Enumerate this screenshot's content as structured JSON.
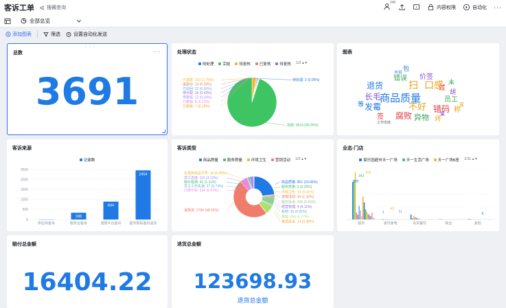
{
  "header": {
    "title": "客诉工单",
    "feedback_label": "搜藏查询",
    "notification_count": "246",
    "permission_label": "内容权限",
    "automation_label": "自动化"
  },
  "view": {
    "selected": "全部总览"
  },
  "toolbar": {
    "add_chart": "添加图表",
    "filter": "筛选",
    "auto_send": "设置自动化发送"
  },
  "cards": {
    "total": {
      "title": "总数",
      "value": "3691"
    },
    "status": {
      "title": "处理状态"
    },
    "wordcloud": {
      "title": "图表"
    },
    "source": {
      "title": "客诉来源"
    },
    "type": {
      "title": "客诉类型"
    },
    "store": {
      "title": "业态-门店"
    },
    "compensation": {
      "title": "赔付总金额",
      "value": "16404.22"
    },
    "refund": {
      "title": "退货总金额",
      "value": "123698.93",
      "caption": "退货总金额"
    }
  },
  "wordcloud_words": [
    {
      "text": "商品质量",
      "color": "#1f7ae6"
    },
    {
      "text": "扫",
      "color": "#e8a317"
    },
    {
      "text": "口感",
      "color": "#e8a317"
    },
    {
      "text": "退货",
      "color": "#1f7ae6"
    },
    {
      "text": "价签",
      "color": "#8a4fd8"
    },
    {
      "text": "错误",
      "color": "#3aa655"
    },
    {
      "text": "长毛",
      "color": "#8a4fd8"
    },
    {
      "text": "发霉",
      "color": "#1f7ae6"
    },
    {
      "text": "不好",
      "color": "#e8a317"
    },
    {
      "text": "错码",
      "color": "#d83b3b"
    },
    {
      "text": "员工",
      "color": "#3aa655"
    },
    {
      "text": "腐败",
      "color": "#d83b3b"
    },
    {
      "text": "异物",
      "color": "#3aa655"
    },
    {
      "text": "坏",
      "color": "#e8a317"
    },
    {
      "text": "包",
      "color": "#1f7ae6"
    },
    {
      "text": "过",
      "color": "#d83b3b"
    },
    {
      "text": "称",
      "color": "#e8a317"
    },
    {
      "text": "胡",
      "color": "#8a4fd8"
    },
    {
      "text": "未",
      "color": "#3aa655"
    },
    {
      "text": "等",
      "color": "#1f7ae6"
    },
    {
      "text": "签",
      "color": "#d83b3b"
    },
    {
      "text": "不符",
      "color": "#1f7ae6"
    },
    {
      "text": "工作态度",
      "color": "#646a73"
    },
    {
      "text": "客",
      "color": "#e8a317"
    },
    {
      "text": "量",
      "color": "#8a4fd8"
    }
  ],
  "chart_data": [
    {
      "type": "pie",
      "title": "处理状态",
      "legend": [
        "待处理",
        "完结",
        "待复核",
        "已复核",
        "待复核"
      ],
      "legend_colors": [
        "#1f7ae6",
        "#3fc464",
        "#f5b62a",
        "#f07c6b",
        "#9c6ad9"
      ],
      "legend_page": "1/2",
      "slices": [
        {
          "label": "完结",
          "value": 3514,
          "pct": "95.20%",
          "color": "#3fc464"
        },
        {
          "label": "已退款",
          "value": 103,
          "pct": "2.79%",
          "color": "#f5b62a"
        },
        {
          "label": "退款中",
          "value": 14,
          "pct": "0.38%",
          "color": "#f07c6b"
        },
        {
          "label": "已驳回",
          "value": 22,
          "pct": "0.60%",
          "color": "#5ab0e8"
        },
        {
          "label": "待分配",
          "value": 16,
          "pct": "0.43%",
          "color": "#9c6ad9"
        },
        {
          "label": "待复核",
          "value": 12,
          "pct": "0.33%",
          "color": "#a78bfa"
        },
        {
          "label": "已撤销",
          "value": 8,
          "pct": "0.22%",
          "color": "#e88adf"
        },
        {
          "label": "已复核",
          "value": 7,
          "pct": "0.19%",
          "color": "#f5a623"
        },
        {
          "label": "待处理",
          "value": 2,
          "pct": "0.05%",
          "color": "#1f7ae6"
        }
      ],
      "labels": [
        "已退款: 103 (2.79%)",
        "退款中: 14 (0.38%)",
        "已驳回: 22 (0.60%)",
        "待分配: 16 (0.43%)",
        "待复核: 12 (0.33%)",
        "已撤销: 8 (0.22%)",
        "已复核: 7 (0.19%)",
        "待处理: 2 (0.05%)",
        "完结: 3514 (95.20%)"
      ]
    },
    {
      "type": "bar",
      "title": "客诉来源",
      "legend": [
        "记录数"
      ],
      "categories": [
        "供应商客诉",
        "服务台客诉",
        "诺阳平台客诉",
        "超市数码客诉退货"
      ],
      "values": [
        5,
        338,
        894,
        2454
      ],
      "ylim": [
        0,
        2500
      ],
      "yticks": [
        0,
        500,
        1000,
        1500,
        2000,
        2500
      ],
      "color": "#1f7ae6"
    },
    {
      "type": "pie",
      "title": "客诉类型",
      "legend": [
        "商品质量",
        "服务质量",
        "环境卫生",
        "营销活动"
      ],
      "legend_colors": [
        "#1f7ae6",
        "#3fc464",
        "#f5b62a",
        "#f07c6b"
      ],
      "legend_page": "1/2",
      "slices": [
        {
          "label": "退换货",
          "value": 1784,
          "color": "#f07c6b"
        },
        {
          "label": "商品质量",
          "value": 851,
          "color": "#1f7ae6"
        },
        {
          "label": "服务质量",
          "value": 2,
          "color": "#3fc464"
        },
        {
          "label": "环境卫生",
          "value": 15,
          "color": "#f5b62a"
        },
        {
          "label": "营销活动",
          "value": 49,
          "color": "#f07c6b"
        },
        {
          "label": "服务投诉",
          "value": 246,
          "color": "#8fd18f"
        },
        {
          "label": "经营管理",
          "value": 4,
          "color": "#9c6ad9"
        },
        {
          "label": "系统",
          "value": 30,
          "color": "#5ab0e8"
        },
        {
          "label": "其他",
          "value": 250,
          "color": "#b0e06a"
        },
        {
          "label": "食品安全",
          "value": 14,
          "color": "#f5a623"
        },
        {
          "label": "口感不好",
          "value": 224,
          "color": "#e88adf"
        },
        {
          "label": "员工工作失误",
          "value": 27,
          "color": "#5ab0e8"
        },
        {
          "label": "称价错误",
          "value": 41,
          "color": "#3fc464"
        },
        {
          "label": "员工态度",
          "value": 115,
          "color": "#a78bfa"
        },
        {
          "label": "价签和商品不符",
          "value": 18,
          "color": "#f5b62a"
        }
      ],
      "labels_left": [
        "价签和商品不符: 18 (0.49%)",
        "员工态度: 115 (3.12%)",
        "称价错误: 41 (1.11%)",
        "员工工作失误: 27 (0.73%)",
        "口感不好: 224 (6.07%)",
        "退换货: 1784 (48.33%)"
      ],
      "labels_right": [
        "商品质量: 851 (23.06%)",
        "服务质量: 2 (0.05%)",
        "环境卫生: 15 (0.41%)",
        "营销活动: 49 (1.33%)",
        "服务投诉: 246 (6.66%)",
        "经营管理: 4 (0.11%)",
        "系统: 30 (0.81%)",
        "其他: 250 (6.77%)",
        "食品安全: 14 (0.38%)"
      ]
    },
    {
      "type": "bar",
      "title": "业态-门店",
      "legend": [
        "家乐园超市天一广场",
        "天一生活广场",
        "天一广场B座"
      ],
      "legend_colors": [
        "#1f7ae6",
        "#3fc464",
        "#f5b62a"
      ],
      "legend_page": "1/11",
      "categories": [
        "超市",
        "通讯家电",
        "百货餐饮",
        "物业",
        "其他"
      ],
      "top_labels": [
        "328",
        "343",
        "413",
        "1",
        "43",
        "11",
        "6"
      ],
      "ylim": [
        0,
        450
      ]
    }
  ]
}
